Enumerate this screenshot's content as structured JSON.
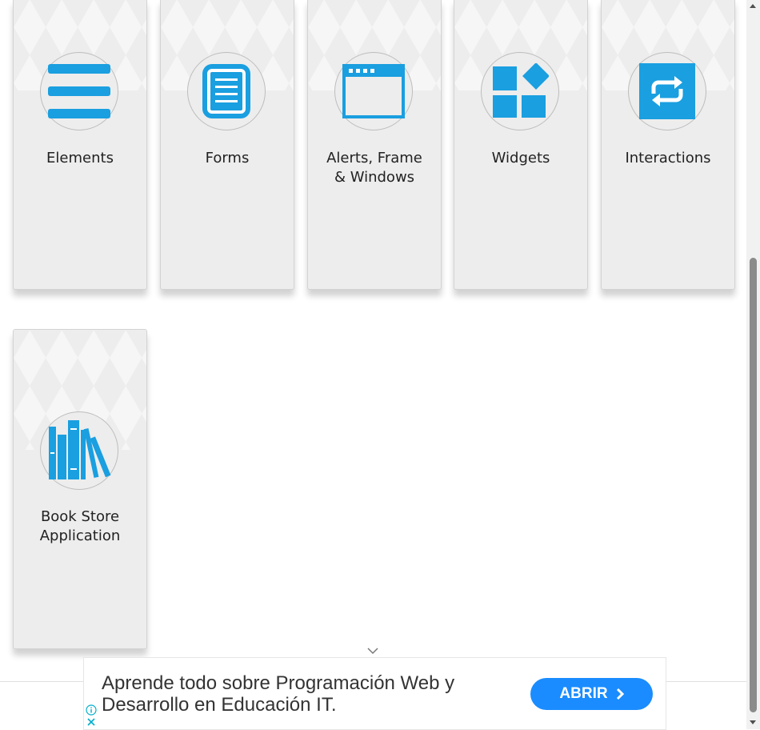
{
  "cards": [
    {
      "title": "Elements",
      "icon": "hamburger-list-icon"
    },
    {
      "title": "Forms",
      "icon": "document-form-icon"
    },
    {
      "title": "Alerts, Frame\n& Windows",
      "icon": "browser-window-icon"
    },
    {
      "title": "Widgets",
      "icon": "widgets-blocks-icon"
    },
    {
      "title": "Interactions",
      "icon": "repeat-arrows-icon"
    },
    {
      "title": "Book Store\nApplication",
      "icon": "books-icon"
    }
  ],
  "ad": {
    "text": "Aprende todo sobre Programación Web y Desarrollo en Educación IT.",
    "button_label": "ABRIR",
    "info_icon": "info-icon",
    "close_icon": "close-icon"
  },
  "colors": {
    "icon_blue": "#1a9fe0",
    "ad_button": "#1a8cff",
    "card_bg": "#ededed"
  }
}
